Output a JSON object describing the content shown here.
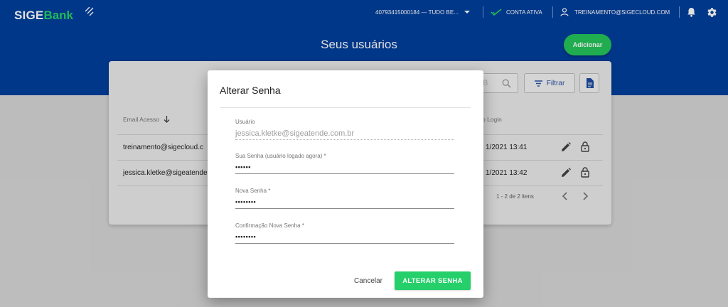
{
  "header": {
    "logo_part1": "SIGE",
    "logo_part2": "Bank",
    "company_selector": "40793415000184 — TUDO BE...",
    "account_status": "CONTA ATIVA",
    "user_email": "TREINAMENTO@SIGECLOUD.COM",
    "icons": [
      "chevron-down-icon",
      "check-mark-icon",
      "user-icon",
      "bell-icon",
      "gear-icon"
    ]
  },
  "page": {
    "title": "Seus usuários",
    "add_button": "Adicionar"
  },
  "table": {
    "search_placeholder": "B",
    "filter_button": "Filtrar",
    "columns": {
      "email": "Email Acesso",
      "last_login": "o Login"
    },
    "rows": [
      {
        "email": "treinamento@sigecloud.c",
        "last_login": "1/2021 13:41"
      },
      {
        "email": "jessica.kletke@sigeatende",
        "last_login": "1/2021 13:42"
      }
    ],
    "pagination": "1 - 2 de 2 itens"
  },
  "dialog": {
    "title": "Alterar Senha",
    "fields": [
      {
        "label": "Usuário",
        "value": "jessica.kletke@sigeatende.com.br"
      },
      {
        "label": "Sua Senha (usuário logado agora) *",
        "value": "••••••"
      },
      {
        "label": "Nova Senha *",
        "value": "••••••••"
      },
      {
        "label": "Confirmação Nova Senha *",
        "value": "••••••••"
      }
    ],
    "cancel_button": "Cancelar",
    "confirm_button": "ALTERAR SENHA"
  },
  "colors": {
    "header_bg": "#003f9c",
    "accent_green": "#25d06a",
    "link_blue": "#2b52a5"
  }
}
